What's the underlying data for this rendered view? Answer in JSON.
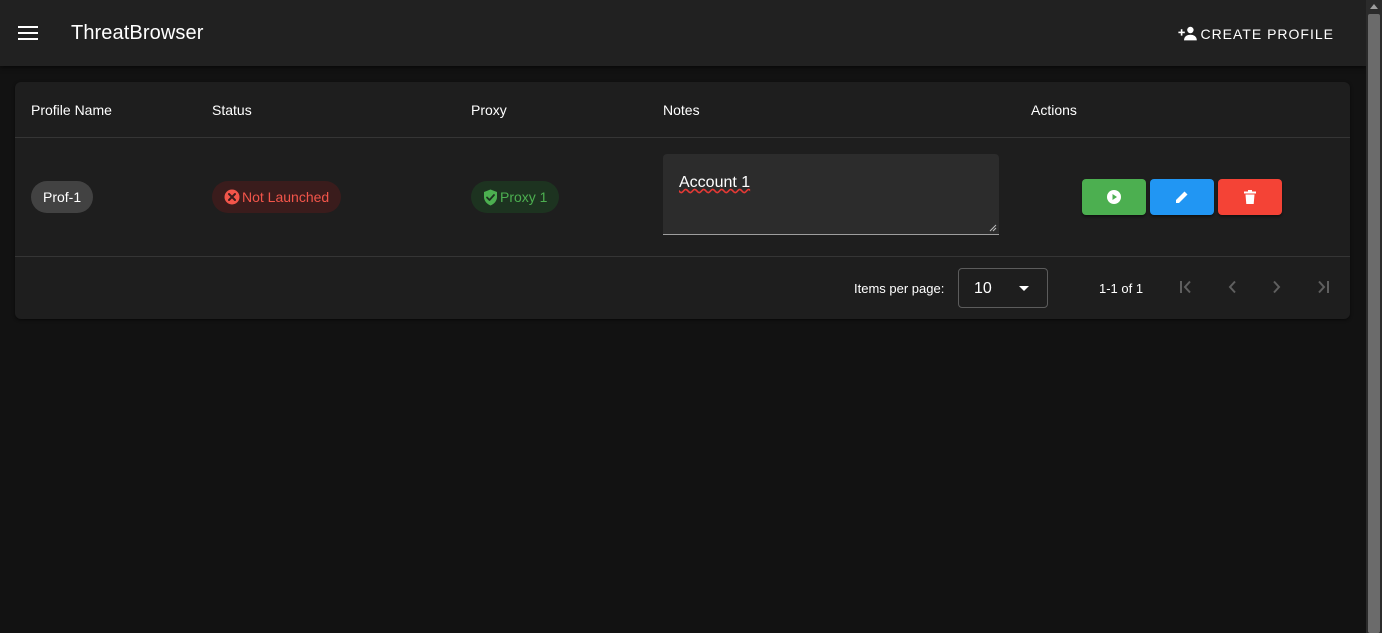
{
  "app_bar": {
    "title": "ThreatBrowser",
    "create_label": "CREATE PROFILE"
  },
  "table": {
    "headers": {
      "profile_name": "Profile Name",
      "status": "Status",
      "proxy": "Proxy",
      "notes": "Notes",
      "actions": "Actions"
    },
    "rows": [
      {
        "profile_name": "Prof-1",
        "status": "Not Launched",
        "proxy": "Proxy 1",
        "notes": "Account 1"
      }
    ]
  },
  "pagination": {
    "items_per_page_label": "Items per page:",
    "items_per_page_value": "10",
    "range": "1-1 of 1"
  },
  "colors": {
    "launch": "#4caf50",
    "edit": "#2196f3",
    "delete": "#f44336",
    "status_error": "#f2554a",
    "proxy_ok": "#4caf50"
  },
  "icons": {
    "menu": "menu-icon",
    "create": "person-add-icon",
    "status": "error-circle-icon",
    "proxy": "shield-check-icon",
    "launch": "play-circle-icon",
    "edit": "pencil-icon",
    "delete": "trash-icon",
    "first": "first-page-icon",
    "prev": "chevron-left-icon",
    "next": "chevron-right-icon",
    "last": "last-page-icon"
  }
}
